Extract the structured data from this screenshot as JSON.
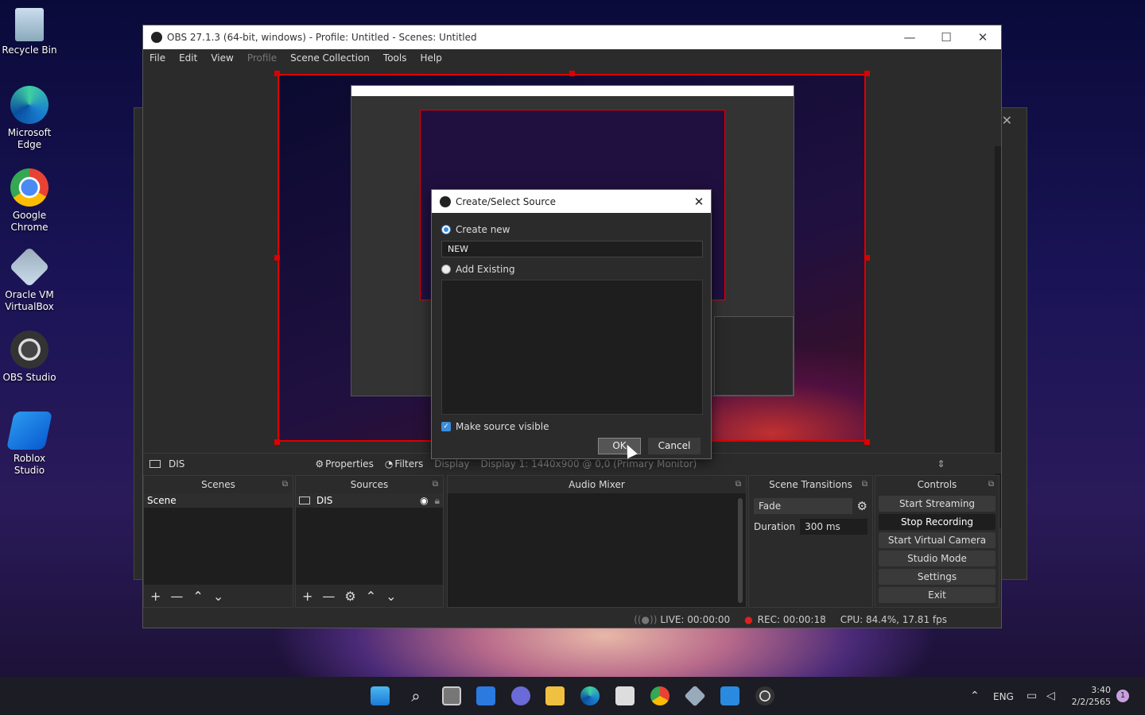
{
  "desktop": {
    "icons": [
      {
        "label": "Recycle Bin"
      },
      {
        "label": "Microsoft Edge"
      },
      {
        "label": "Google Chrome"
      },
      {
        "label": "Oracle VM VirtualBox"
      },
      {
        "label": "OBS Studio"
      },
      {
        "label": "Roblox Studio"
      }
    ]
  },
  "window": {
    "title": "OBS 27.1.3 (64-bit, windows) - Profile: Untitled - Scenes: Untitled",
    "menu": [
      "File",
      "Edit",
      "View",
      "Profile",
      "Scene Collection",
      "Tools",
      "Help"
    ]
  },
  "sourcebar": {
    "source": "DIS",
    "properties": "Properties",
    "filters": "Filters",
    "display_label": "Display",
    "display_value": "Display 1: 1440x900 @ 0,0 (Primary Monitor)"
  },
  "docks": {
    "scenes": {
      "title": "Scenes",
      "items": [
        "Scene"
      ]
    },
    "sources": {
      "title": "Sources",
      "items": [
        "DIS"
      ]
    },
    "mixer": {
      "title": "Audio Mixer"
    },
    "transitions": {
      "title": "Scene Transitions",
      "transition": "Fade",
      "duration_label": "Duration",
      "duration": "300 ms"
    },
    "controls": {
      "title": "Controls",
      "buttons": [
        "Start Streaming",
        "Stop Recording",
        "Start Virtual Camera",
        "Studio Mode",
        "Settings",
        "Exit"
      ]
    }
  },
  "status": {
    "live": "LIVE: 00:00:00",
    "rec": "REC: 00:00:18",
    "cpu": "CPU: 84.4%, 17.81 fps"
  },
  "dialog": {
    "title": "Create/Select Source",
    "create_new": "Create new",
    "name_value": "NEW",
    "add_existing": "Add Existing",
    "make_visible": "Make source visible",
    "ok": "OK",
    "cancel": "Cancel"
  },
  "taskbar": {
    "lang": "ENG",
    "time": "3:40",
    "date": "2/2/2565",
    "notif": "1"
  },
  "colors": {
    "selection_border": "#dd0000",
    "accent": "#3c8cdc",
    "rec_dot": "#e02020"
  }
}
